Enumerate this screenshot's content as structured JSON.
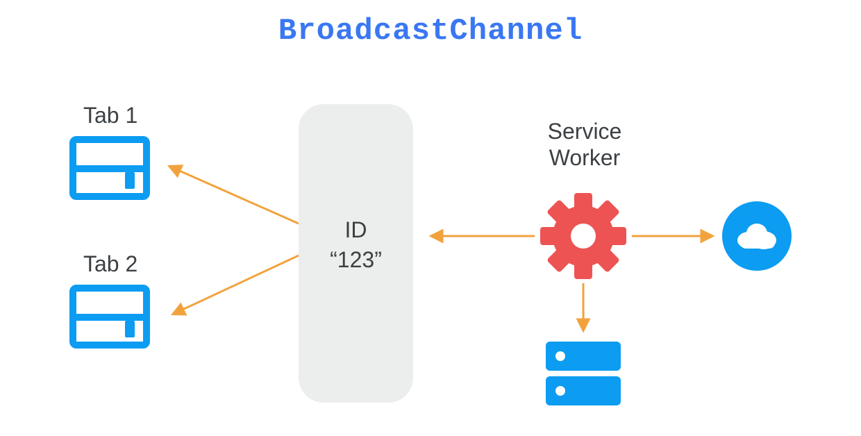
{
  "title": "BroadcastChannel",
  "tabs": [
    {
      "label": "Tab 1"
    },
    {
      "label": "Tab 2"
    }
  ],
  "channel": {
    "id_label": "ID",
    "id_value": "“123”"
  },
  "service_worker": {
    "line1": "Service",
    "line2": "Worker"
  },
  "colors": {
    "title": "#3a77f2",
    "accent_blue": "#0c9cf2",
    "accent_red": "#ed5353",
    "arrow": "#f2a23c",
    "pill_bg": "#eceded",
    "text": "#3c4043"
  },
  "icons": {
    "tab": "browser-window-icon",
    "gear": "gear-icon",
    "cloud": "cloud-icon",
    "server": "server-icon"
  }
}
